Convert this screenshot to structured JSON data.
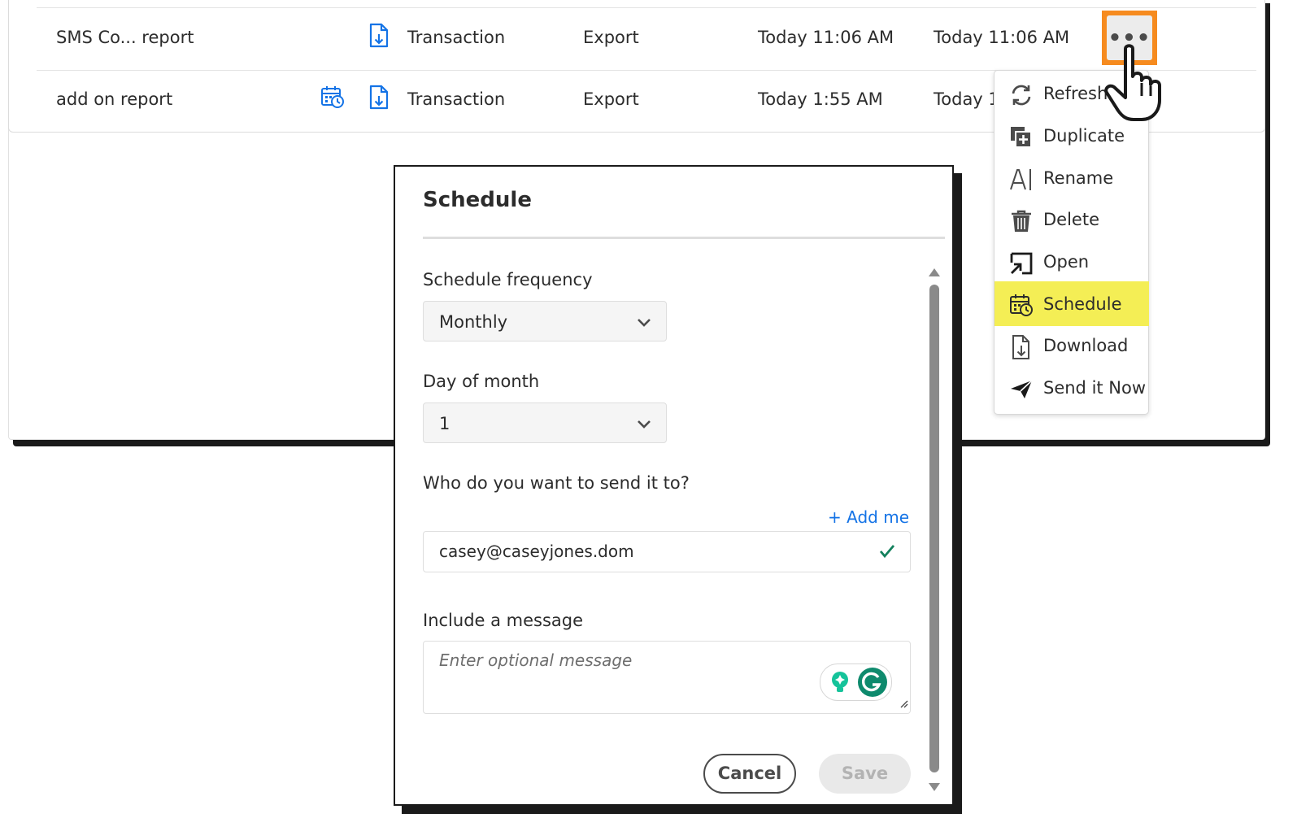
{
  "table": {
    "rows": [
      {
        "name": "SMS Co...  report",
        "type": "Transaction",
        "action": "Export",
        "created": "Today 11:06 AM",
        "modified": "Today 11:06 AM",
        "scheduled": false
      },
      {
        "name": "add on report",
        "type": "Transaction",
        "action": "Export",
        "created": "Today 1:55 AM",
        "modified": "Today 10",
        "scheduled": true
      }
    ],
    "more_button_label": "•••"
  },
  "context_menu": {
    "items": [
      {
        "label": "Refresh",
        "icon": "refresh-icon"
      },
      {
        "label": "Duplicate",
        "icon": "duplicate-icon"
      },
      {
        "label": "Rename",
        "icon": "rename-icon"
      },
      {
        "label": "Delete",
        "icon": "trash-icon"
      },
      {
        "label": "Open",
        "icon": "open-icon"
      },
      {
        "label": "Schedule",
        "icon": "schedule-icon",
        "highlighted": true
      },
      {
        "label": "Download",
        "icon": "download-icon"
      },
      {
        "label": "Send it Now",
        "icon": "send-icon"
      }
    ]
  },
  "modal": {
    "title": "Schedule",
    "frequency": {
      "label": "Schedule frequency",
      "value": "Monthly"
    },
    "day_of_month": {
      "label": "Day of month",
      "value": "1"
    },
    "recipients": {
      "label": "Who do you want to send it to?",
      "add_me": "+ Add me",
      "email": "casey@caseyjones.dom"
    },
    "message": {
      "label": "Include a message",
      "placeholder": "Enter optional message"
    },
    "cancel_label": "Cancel",
    "save_label": "Save"
  },
  "colors": {
    "accent_blue": "#1473e6",
    "highlight_orange": "#f68b1f",
    "menu_highlight": "#f4ee55",
    "check_green": "#12805c",
    "grammarly_green": "#15c39a"
  }
}
